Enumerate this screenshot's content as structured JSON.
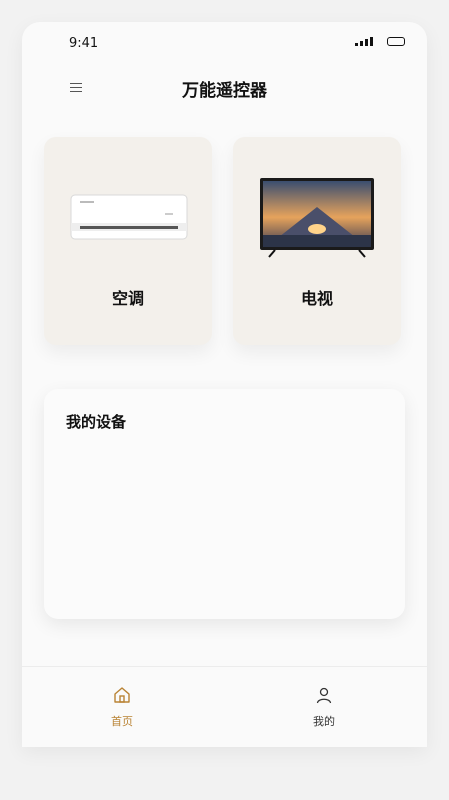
{
  "status": {
    "time": "9:41"
  },
  "header": {
    "title": "万能遥控器"
  },
  "cards": [
    {
      "label": "空调",
      "icon": "air-conditioner-image"
    },
    {
      "label": "电视",
      "icon": "television-image"
    }
  ],
  "devices": {
    "title": "我的设备"
  },
  "tabs": [
    {
      "label": "首页",
      "icon": "home-icon",
      "active": true
    },
    {
      "label": "我的",
      "icon": "user-icon",
      "active": false
    }
  ],
  "colors": {
    "accent": "#b98334",
    "card_bg": "#f3f0eb"
  }
}
